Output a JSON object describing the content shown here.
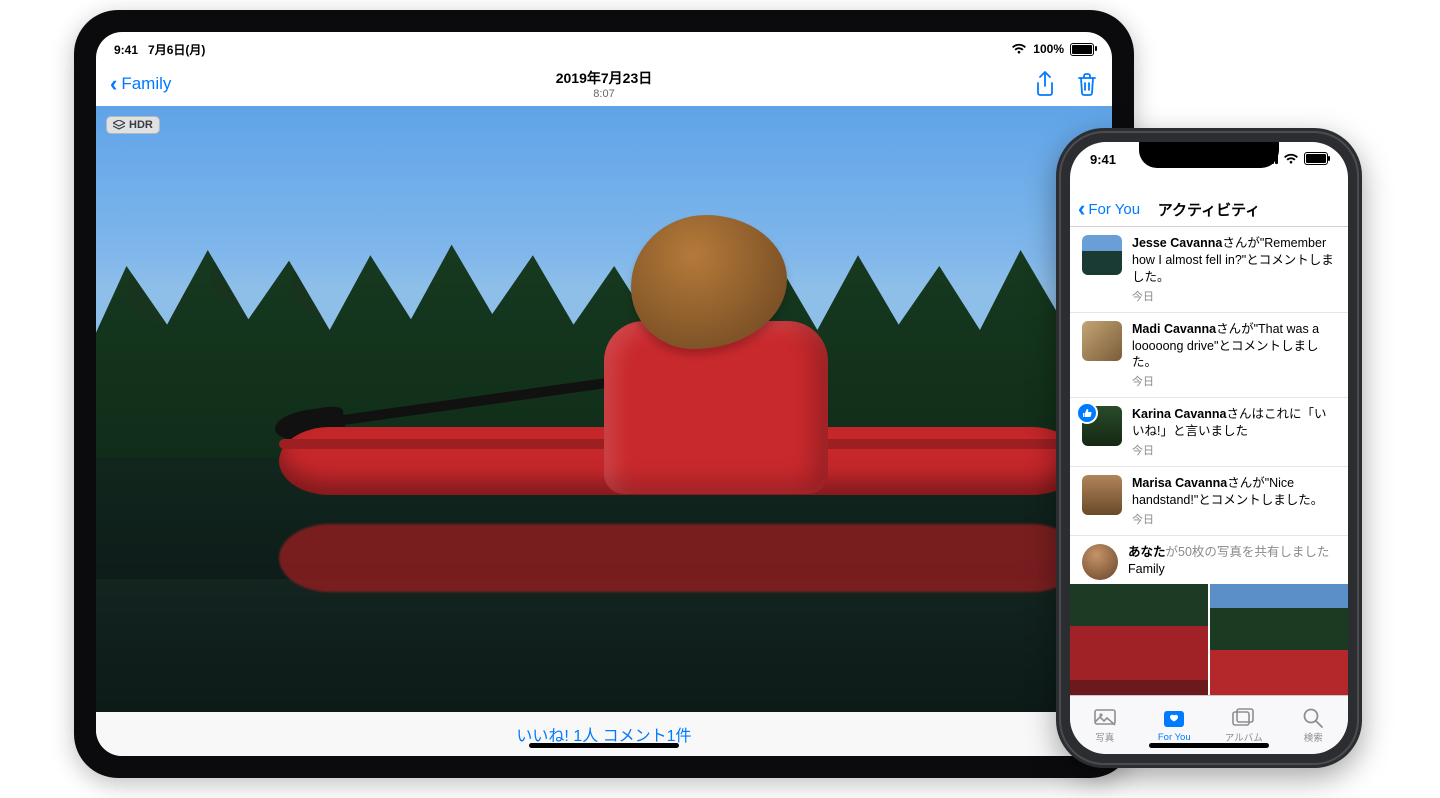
{
  "ipad": {
    "status": {
      "time": "9:41",
      "date": "7月6日(月)",
      "battery": "100%"
    },
    "nav": {
      "back_label": "Family",
      "title_date": "2019年7月23日",
      "title_time": "8:07"
    },
    "photo": {
      "badge": "HDR"
    },
    "footer": {
      "likes_comments": "いいね! 1人 コメント1件"
    }
  },
  "iphone": {
    "status": {
      "time": "9:41"
    },
    "nav": {
      "back_label": "For You",
      "title": "アクティビティ"
    },
    "activity": [
      {
        "name": "Jesse Cavanna",
        "suffix": "さんが\"Remember how I almost fell in?\"とコメントしました。",
        "timestamp": "今日",
        "liked": false,
        "thumb": "t1"
      },
      {
        "name": "Madi Cavanna",
        "suffix": "さんが\"That was a looooong drive\"とコメントしました。",
        "timestamp": "今日",
        "liked": false,
        "thumb": "t2"
      },
      {
        "name": "Karina Cavanna",
        "suffix": "さんはこれに「いいね!」と言いました",
        "timestamp": "今日",
        "liked": true,
        "thumb": "t3"
      },
      {
        "name": "Marisa Cavanna",
        "suffix": "さんが\"Nice handstand!\"とコメントしました。",
        "timestamp": "今日",
        "liked": false,
        "thumb": "t4"
      }
    ],
    "shared": {
      "you": "あなた",
      "suffix": "が50枚の写真を共有しました",
      "album": "Family"
    },
    "tabs": [
      {
        "label": "写真",
        "icon": "photos"
      },
      {
        "label": "For You",
        "icon": "foryou"
      },
      {
        "label": "アルバム",
        "icon": "albums"
      },
      {
        "label": "検索",
        "icon": "search"
      }
    ],
    "active_tab": 1
  }
}
